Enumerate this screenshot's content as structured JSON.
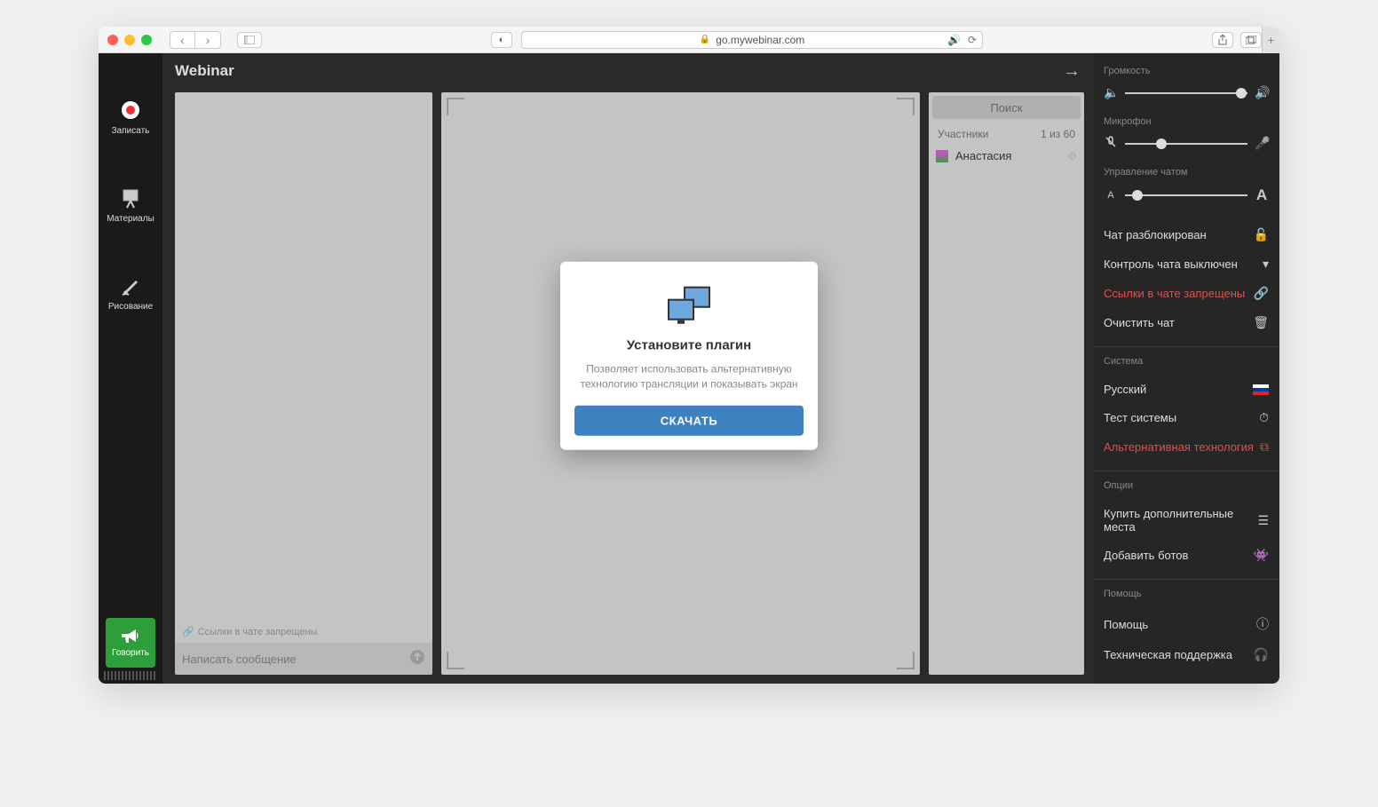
{
  "browser": {
    "url": "go.mywebinar.com"
  },
  "header": {
    "title": "Webinar"
  },
  "sidebar": {
    "record": "Записать",
    "materials": "Материалы",
    "drawing": "Рисование",
    "speak": "Говорить"
  },
  "chat": {
    "links_locked": "Ссылки в чате запрещены",
    "input_placeholder": "Написать сообщение"
  },
  "participants": {
    "search_placeholder": "Поиск",
    "header_label": "Участники",
    "count": "1 из 60",
    "items": [
      {
        "name": "Анастасия"
      }
    ]
  },
  "settings": {
    "volume_label": "Громкость",
    "mic_label": "Микрофон",
    "chat_mgmt_label": "Управление чатом",
    "chat_unlocked": "Чат разблокирован",
    "chat_control_off": "Контроль чата выключен",
    "links_blocked": "Ссылки в чате запрещены",
    "clear_chat": "Очистить чат",
    "system_label": "Система",
    "language": "Русский",
    "system_test": "Тест системы",
    "alt_tech": "Альтернативная технология",
    "options_label": "Опции",
    "buy_seats": "Купить дополнительные места",
    "add_bots": "Добавить ботов",
    "help_label": "Помощь",
    "help": "Помощь",
    "support": "Техническая поддержка"
  },
  "modal": {
    "title": "Установите плагин",
    "text": "Позволяет использовать альтернативную технологию трансляции и показывать экран",
    "button": "СКАЧАТЬ"
  }
}
